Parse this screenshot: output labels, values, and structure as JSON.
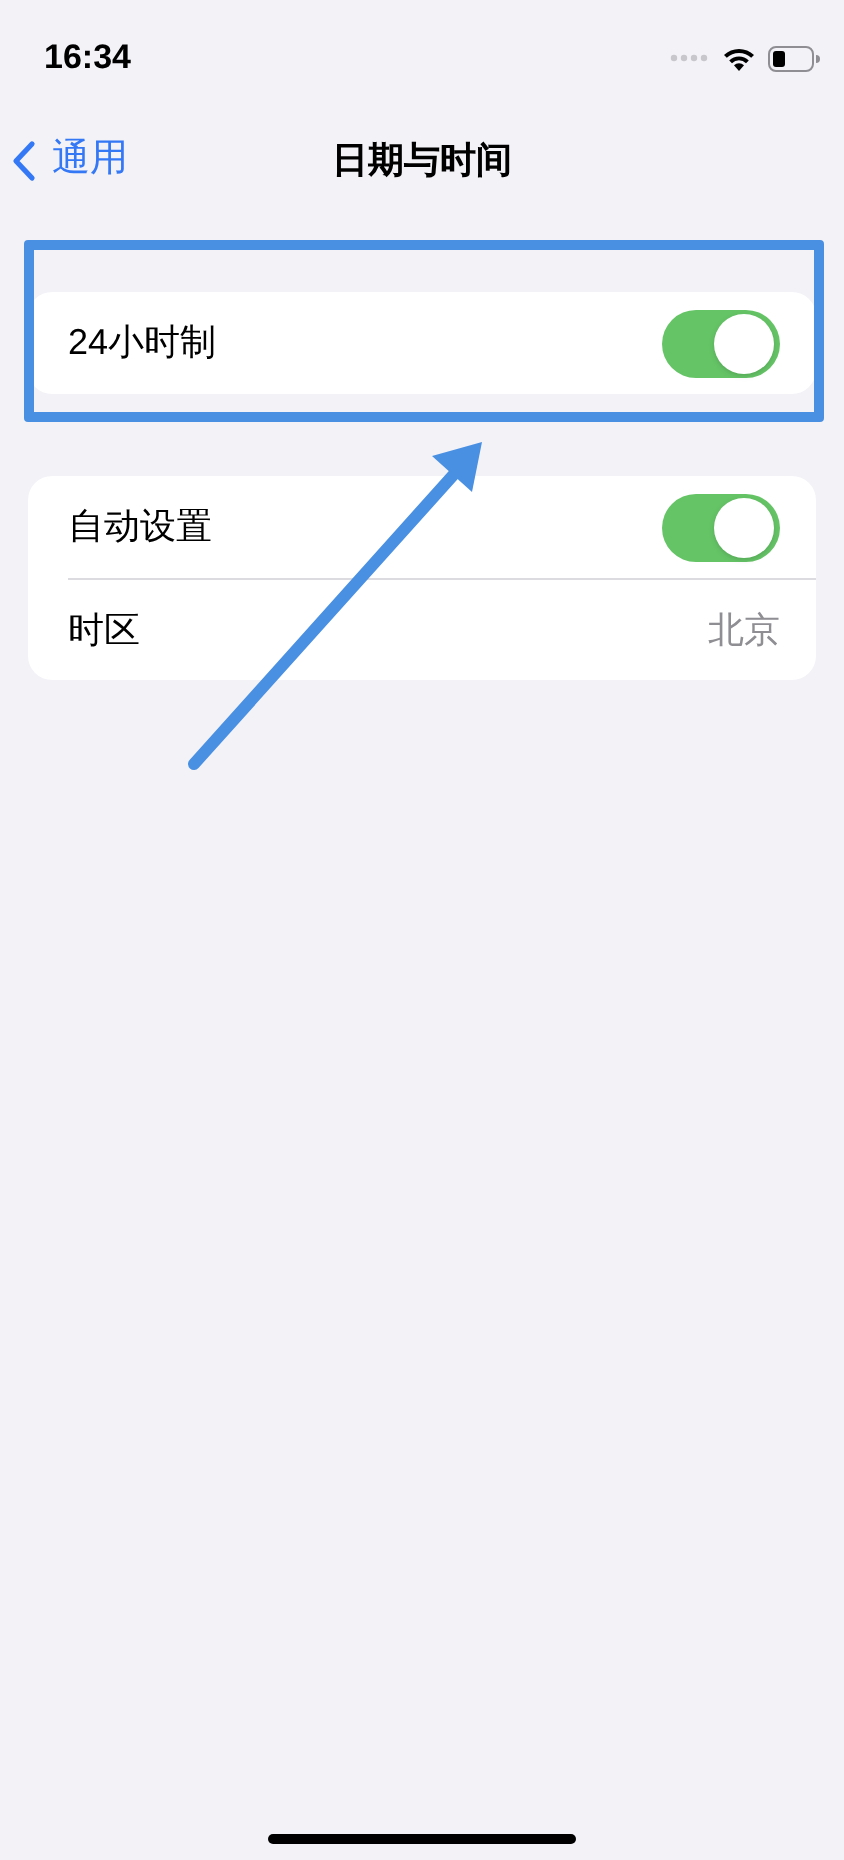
{
  "status_bar": {
    "time": "16:34"
  },
  "nav": {
    "back": "通用",
    "title": "日期与时间"
  },
  "groups": [
    {
      "highlighted": true,
      "rows": [
        {
          "kind": "toggle",
          "label": "24小时制",
          "on": true
        }
      ]
    },
    {
      "highlighted": false,
      "rows": [
        {
          "kind": "toggle",
          "label": "自动设置",
          "on": true
        },
        {
          "kind": "value",
          "label": "时区",
          "value": "北京"
        }
      ]
    }
  ]
}
